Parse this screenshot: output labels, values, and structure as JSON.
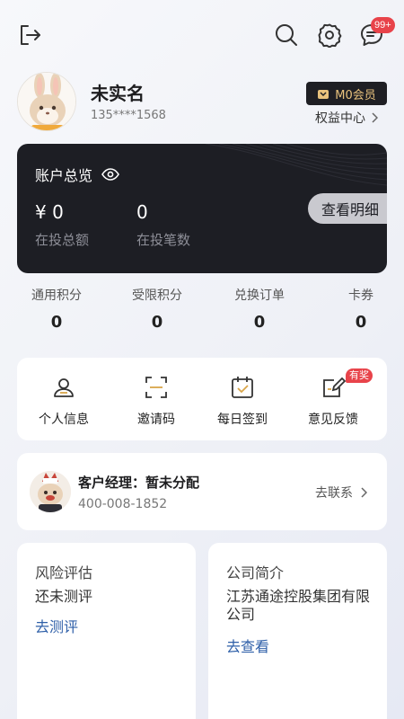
{
  "header": {
    "notification_badge": "99+"
  },
  "profile": {
    "name": "未实名",
    "phone": "135****1568",
    "member_level": "M0会员",
    "benefit_center": "权益中心"
  },
  "account": {
    "title": "账户总览",
    "total_amount": "¥ 0",
    "total_amount_label": "在投总额",
    "total_count": "0",
    "total_count_label": "在投笔数",
    "detail_button": "查看明细"
  },
  "points": [
    {
      "label": "通用积分",
      "value": "0"
    },
    {
      "label": "受限积分",
      "value": "0"
    },
    {
      "label": "兑换订单",
      "value": "0"
    },
    {
      "label": "卡券",
      "value": "0"
    }
  ],
  "quick_actions": [
    {
      "label": "个人信息",
      "icon": "user-icon"
    },
    {
      "label": "邀请码",
      "icon": "scan-icon"
    },
    {
      "label": "每日签到",
      "icon": "calendar-check-icon"
    },
    {
      "label": "意见反馈",
      "icon": "feedback-edit-icon"
    }
  ],
  "prize_tag": "有奖",
  "manager": {
    "title": "客户经理：暂未分配",
    "phone": "400-008-1852",
    "contact_label": "去联系"
  },
  "risk": {
    "title": "风险评估",
    "status": "还未测评",
    "link": "去测评"
  },
  "company": {
    "title": "公司简介",
    "name": "江苏通途控股集团有限公司",
    "link": "去查看"
  },
  "colors": {
    "accent_link": "#2e5fa8",
    "badge_red": "#e8434a",
    "card_dark": "#1d1e24",
    "member_gold": "#e9c27d"
  }
}
